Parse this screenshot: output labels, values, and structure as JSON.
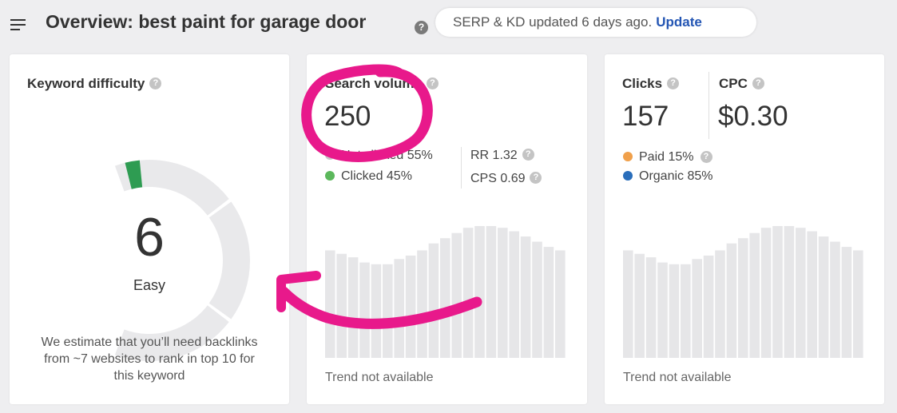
{
  "header": {
    "title": "Overview: best paint for garage door",
    "help_glyph": "?",
    "update_status": "SERP & KD updated 6 days ago.",
    "update_link": "Update"
  },
  "kd_card": {
    "title": "Keyword difficulty",
    "value": "6",
    "label": "Easy",
    "description": "We estimate that you’ll need backlinks from ~7 websites to rank in top 10 for this keyword",
    "score_fraction": 0.06
  },
  "volume_card": {
    "title": "Search volume",
    "value": "250",
    "legend": [
      {
        "label": "Not clicked 55%",
        "color": "#c8c8c8"
      },
      {
        "label": "Clicked 45%",
        "color": "#5cb85c"
      }
    ],
    "metrics": [
      {
        "label": "RR 1.32"
      },
      {
        "label": "CPS 0.69"
      }
    ],
    "trend_note": "Trend not available",
    "trend_values": [
      62,
      60,
      58,
      55,
      54,
      54,
      57,
      59,
      62,
      66,
      69,
      72,
      75,
      76,
      76,
      75,
      73,
      70,
      67,
      64,
      62
    ]
  },
  "clicks_card": {
    "clicks_title": "Clicks",
    "clicks_value": "157",
    "cpc_title": "CPC",
    "cpc_value": "$0.30",
    "legend": [
      {
        "label": "Paid 15%",
        "color": "#f0a04b"
      },
      {
        "label": "Organic 85%",
        "color": "#2a6ebb"
      }
    ],
    "trend_note": "Trend not available",
    "trend_values": [
      62,
      60,
      58,
      55,
      54,
      54,
      57,
      59,
      62,
      66,
      69,
      72,
      75,
      76,
      76,
      75,
      73,
      70,
      67,
      64,
      62
    ]
  },
  "colors": {
    "accent_link": "#2456b4",
    "gauge_track": "#e9e9eb",
    "gauge_fill": "#2e9c52",
    "bar_fill": "#e6e6e8",
    "annotation": "#e8198b"
  }
}
